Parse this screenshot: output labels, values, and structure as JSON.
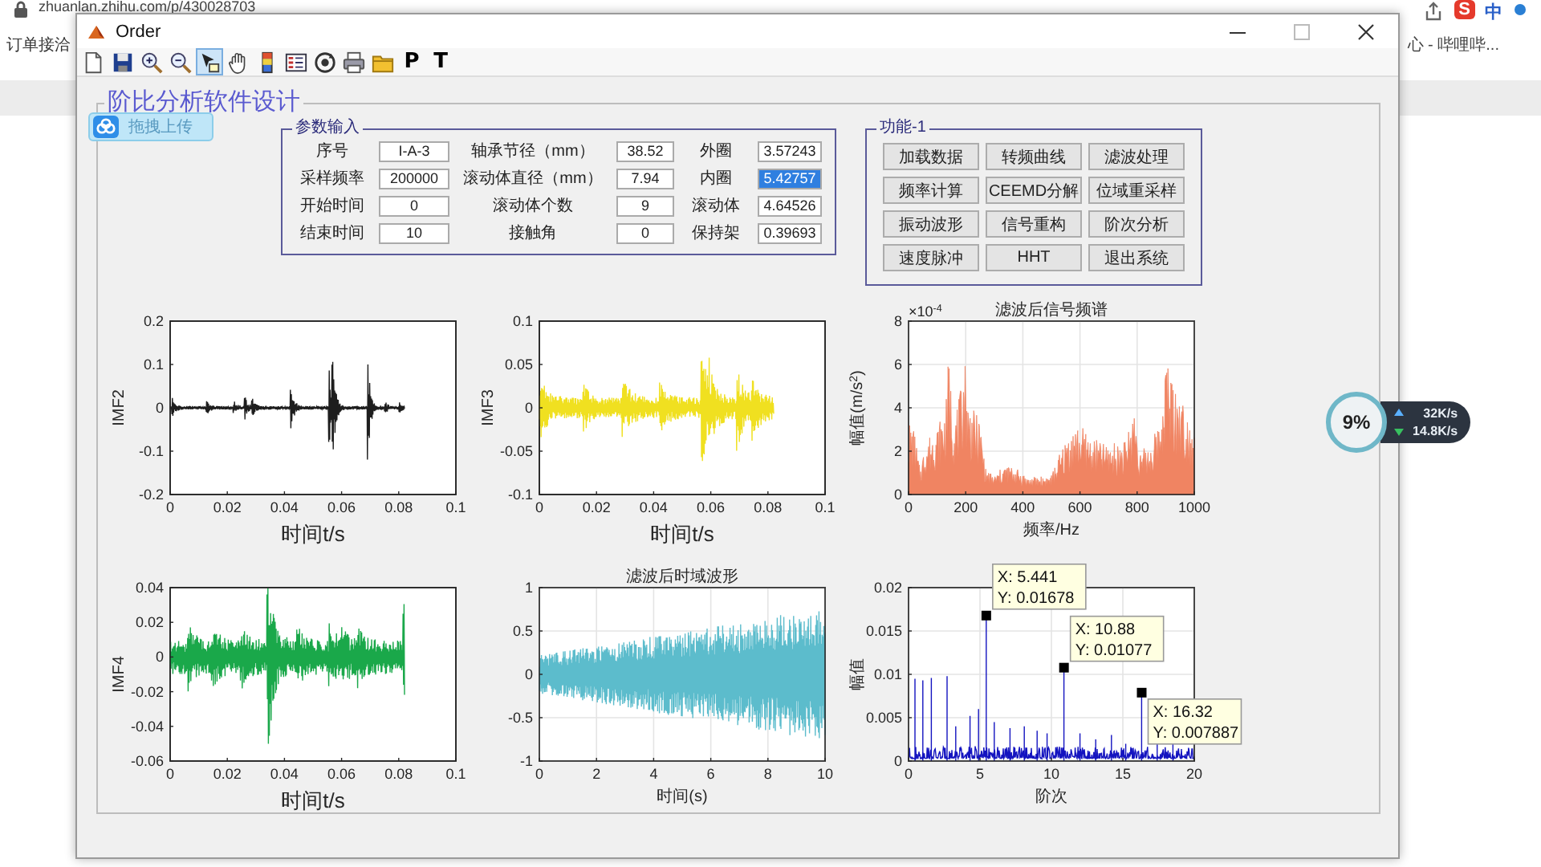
{
  "browser": {
    "url": "zhuanlan.zhihu.com/p/430028703",
    "ime_logo": "S",
    "ime_mode": "中",
    "bookmark": "订单接洽",
    "tab_text": "心 - 哔哩哔..."
  },
  "window": {
    "title": "Order"
  },
  "toolbar": [
    {
      "kind": "new",
      "selected": false
    },
    {
      "kind": "save",
      "selected": false
    },
    {
      "kind": "zoomin",
      "selected": false
    },
    {
      "kind": "zoomout",
      "selected": false
    },
    {
      "kind": "cursor",
      "selected": true
    },
    {
      "kind": "hand",
      "selected": false
    },
    {
      "kind": "colorbar",
      "selected": false
    },
    {
      "kind": "legend",
      "selected": false
    },
    {
      "kind": "rotate",
      "selected": false
    },
    {
      "kind": "print",
      "selected": false
    },
    {
      "kind": "folder",
      "selected": false
    },
    {
      "kind": "letter",
      "text": "P",
      "selected": false
    },
    {
      "kind": "letter",
      "text": "T",
      "selected": false
    }
  ],
  "panel": {
    "title": "阶比分析软件设计"
  },
  "upload_button": "拖拽上传",
  "params": {
    "title": "参数输入",
    "rows": [
      [
        {
          "label": "序号",
          "value": "I-A-3",
          "selected": false
        },
        {
          "label": "轴承节径（mm）",
          "value": "38.52",
          "selected": false
        },
        {
          "label": "外圈",
          "value": "3.57243",
          "selected": false
        }
      ],
      [
        {
          "label": "采样频率",
          "value": "200000",
          "selected": false
        },
        {
          "label": "滚动体直径（mm）",
          "value": "7.94",
          "selected": false
        },
        {
          "label": "内圈",
          "value": "5.42757",
          "selected": true
        }
      ],
      [
        {
          "label": "开始时间",
          "value": "0",
          "selected": false
        },
        {
          "label": "滚动体个数",
          "value": "9",
          "selected": false
        },
        {
          "label": "滚动体",
          "value": "4.64526",
          "selected": false
        }
      ],
      [
        {
          "label": "结束时间",
          "value": "10",
          "selected": false
        },
        {
          "label": "接触角",
          "value": "0",
          "selected": false
        },
        {
          "label": "保持架",
          "value": "0.39693",
          "selected": false
        }
      ]
    ]
  },
  "functions": {
    "title": "功能-1",
    "buttons": [
      "加载数据",
      "转频曲线",
      "滤波处理",
      "频率计算",
      "CEEMD分解",
      "位域重采样",
      "振动波形",
      "信号重构",
      "阶次分析",
      "速度脉冲",
      "HHT",
      "退出系统"
    ]
  },
  "plots": [
    {
      "kind": "impulses",
      "color": "#1e1e1e",
      "grid": false,
      "ylabel": "IMF2",
      "xlabel": "时间t/s",
      "yticks": [
        "0.2",
        "0.1",
        "0",
        "-0.1",
        "-0.2"
      ],
      "xticks": [
        "0",
        "0.02",
        "0.04",
        "0.06",
        "0.08",
        "0.1"
      ]
    },
    {
      "kind": "bursts",
      "color": "#f0e020",
      "grid": false,
      "ylabel": "IMF3",
      "xlabel": "时间t/s",
      "yticks": [
        "0.1",
        "0.05",
        "0",
        "-0.05",
        "-0.1"
      ],
      "xticks": [
        "0",
        "0.02",
        "0.04",
        "0.06",
        "0.08",
        "0.1"
      ]
    },
    {
      "kind": "spectrum",
      "color": "#f08462",
      "grid": true,
      "title": "滤波后信号频谱",
      "exponent": "×10$^{-4}$",
      "ylabel": "幅值(m/s$^{2}$)",
      "xlabel": "频率/Hz",
      "yticks": [
        "8",
        "6",
        "4",
        "2",
        "0"
      ],
      "xticks": [
        "0",
        "200",
        "400",
        "600",
        "800",
        "1000"
      ]
    },
    {
      "kind": "spikes",
      "color": "#1aa84a",
      "grid": false,
      "ylabel": "IMF4",
      "xlabel": "时间t/s",
      "yticks": [
        "0.04",
        "0.02",
        "0",
        "-0.02",
        "-0.04",
        "-0.06"
      ],
      "xticks": [
        "0",
        "0.02",
        "0.04",
        "0.06",
        "0.08",
        "0.1"
      ]
    },
    {
      "kind": "growing",
      "color": "#5cbccc",
      "grid": true,
      "title": "滤波后时域波形",
      "xlabel": "时间(s)",
      "yticks": [
        "1",
        "0.5",
        "0",
        "-0.5",
        "-1"
      ],
      "xticks": [
        "0",
        "2",
        "4",
        "6",
        "8",
        "10"
      ]
    },
    {
      "kind": "orders",
      "color": "#1414c0",
      "grid": true,
      "ylabel": "幅值",
      "xlabel": "阶次",
      "yticks": [
        "0.02",
        "0.015",
        "0.01",
        "0.005",
        "0"
      ],
      "xticks": [
        "0",
        "5",
        "10",
        "15",
        "20"
      ],
      "datatips": [
        {
          "x": "X: 5.441",
          "y": "Y: 0.01678"
        },
        {
          "x": "X: 10.88",
          "y": "Y: 0.01077"
        },
        {
          "x": "X: 16.32",
          "y": "Y: 0.007887"
        }
      ]
    }
  ],
  "net_widget": {
    "percent": "9%",
    "upload": "32K/s",
    "download": "14.8K/s"
  }
}
